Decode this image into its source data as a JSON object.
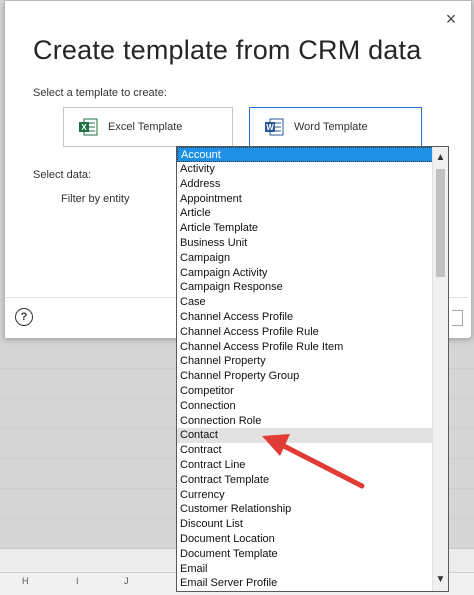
{
  "dialog": {
    "title": "Create template from CRM data",
    "close_glyph": "×",
    "select_template_label": "Select a template to create:",
    "templates": [
      {
        "label": "Excel Template",
        "icon": "excel-icon",
        "color": "#1d7044"
      },
      {
        "label": "Word Template",
        "icon": "word-icon",
        "color": "#2b5797"
      }
    ],
    "select_data_label": "Select data:",
    "filter_label": "Filter by entity",
    "help_glyph": "?"
  },
  "dropdown": {
    "selected": "Account",
    "highlighted": "Contact",
    "items": [
      "Account",
      "Activity",
      "Address",
      "Appointment",
      "Article",
      "Article Template",
      "Business Unit",
      "Campaign",
      "Campaign Activity",
      "Campaign Response",
      "Case",
      "Channel Access Profile",
      "Channel Access Profile Rule",
      "Channel Access Profile Rule Item",
      "Channel Property",
      "Channel Property Group",
      "Competitor",
      "Connection",
      "Connection Role",
      "Contact",
      "Contract",
      "Contract Line",
      "Contract Template",
      "Currency",
      "Customer Relationship",
      "Discount List",
      "Document Location",
      "Document Template",
      "Email",
      "Email Server Profile"
    ],
    "scroll_up": "▲",
    "scroll_down": "▼"
  },
  "sheet": {
    "columns": [
      "H",
      "I",
      "J"
    ]
  },
  "colors": {
    "selection": "#1e90e6",
    "annotation_arrow": "#e03b35"
  }
}
